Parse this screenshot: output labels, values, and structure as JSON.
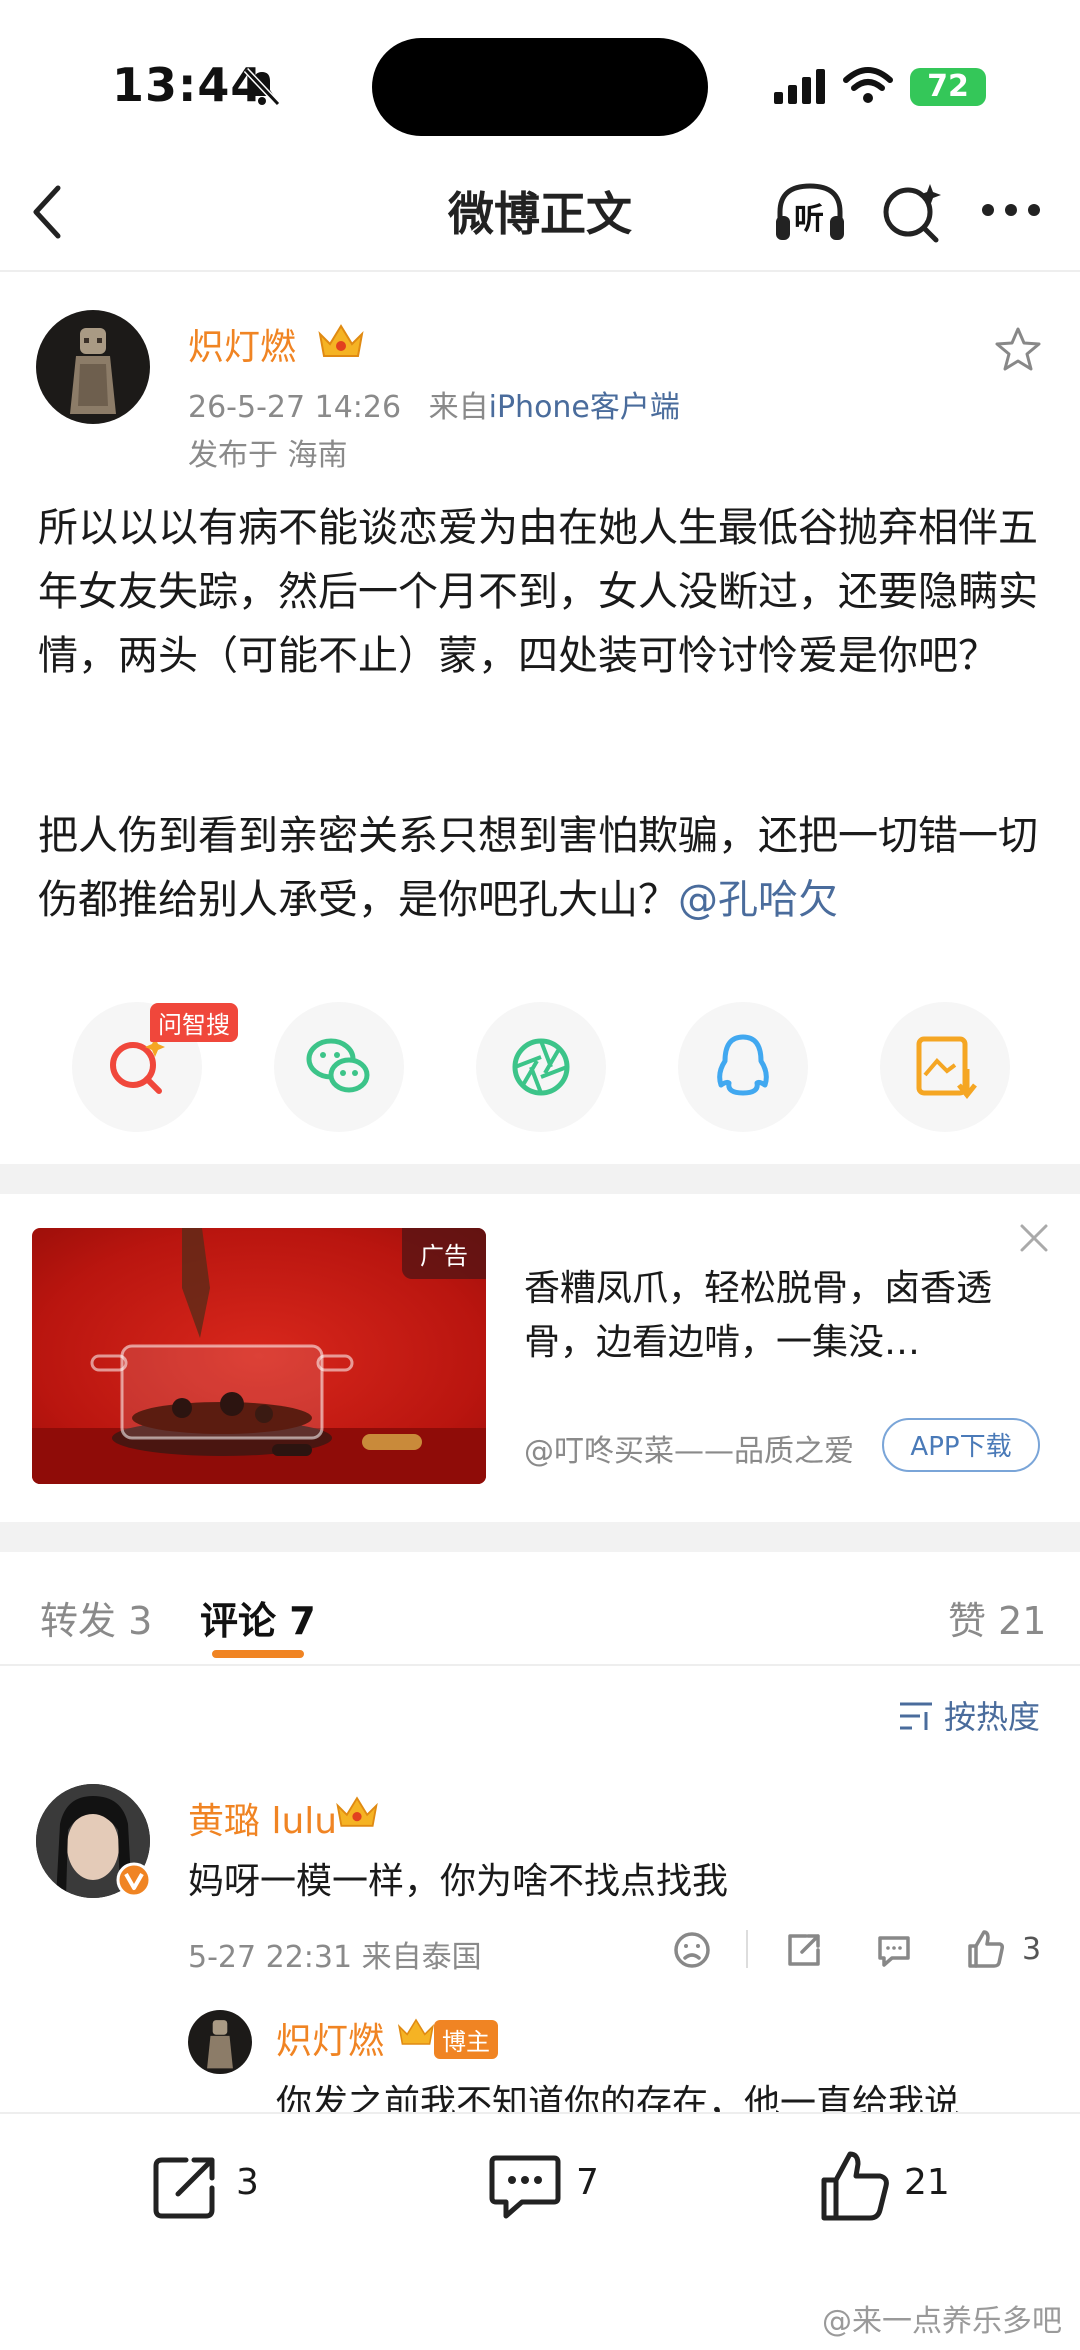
{
  "status_bar": {
    "time": "13:44",
    "battery": "72"
  },
  "nav": {
    "title": "微博正文",
    "listen_label": "听"
  },
  "post": {
    "username": "炽灯燃",
    "datetime": "26-5-27 14:26",
    "source_prefix": "来自",
    "source": "iPhone客户端",
    "location": "发布于 海南",
    "paragraph1": "所以以以有病不能谈恋爱为由在她人生最低谷抛弃相伴五年女友失踪，然后一个月不到，女人没断过，还要隐瞒实情，两头（可能不止）蒙，四处装可怜讨怜爱是你吧？",
    "paragraph2": "把人伤到看到亲密关系只想到害怕欺骗，还把一切错一切伤都推给别人承受，是你吧孔大山？",
    "mention": "@孔哈欠"
  },
  "share": {
    "ai_badge": "问智搜"
  },
  "ad": {
    "tag": "广告",
    "title": "香糟凤爪，轻松脱骨，卤香透骨，边看边啃，一集没…",
    "source": "@叮咚买菜——品质之爱",
    "button": "APP下载"
  },
  "tabs": {
    "repost": "转发 3",
    "comment": "评论 7",
    "like": "赞 21"
  },
  "sort_label": "按热度",
  "comments": [
    {
      "username": "黄璐 lulu",
      "text": "妈呀一模一样，你为啥不找点找我",
      "meta": "5-27 22:31 来自泰国",
      "likes": "3"
    }
  ],
  "reply": {
    "username": "炽灯燃",
    "badge": "博主",
    "text": "你发之前我不知道你的存在，他一直给我说"
  },
  "bottom": {
    "reposts": "3",
    "comments": "7",
    "likes": "21"
  },
  "watermark": "@来一点养乐多吧",
  "colors": {
    "accent": "#f08423",
    "link": "#4a6c9c",
    "ai_badge": "#f0473b"
  }
}
